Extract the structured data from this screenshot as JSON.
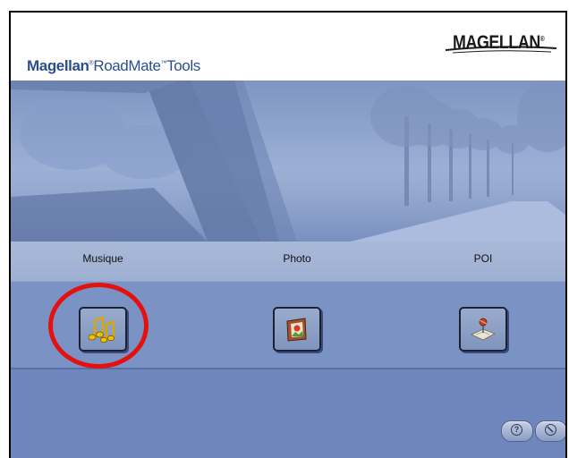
{
  "header": {
    "app_title_brand": "Magellan",
    "app_title_mark": "®",
    "app_title_product": "RoadMate",
    "app_title_tm": "™",
    "app_title_suffix": "Tools",
    "logo_text": "MAGELLAN",
    "logo_mark": "®"
  },
  "tools": [
    {
      "label": "Musique",
      "icon": "music-notes-icon"
    },
    {
      "label": "Photo",
      "icon": "picture-frame-icon"
    },
    {
      "label": "POI",
      "icon": "map-pin-icon"
    }
  ],
  "footer": {
    "help_icon": "help-icon",
    "close_icon": "close-icon",
    "help_symbol": "?"
  },
  "colors": {
    "title_blue": "#2b4f8c",
    "labels_band": "#a9b9d8",
    "buttons_band": "#7b92c4",
    "highlight": "#e51010"
  }
}
